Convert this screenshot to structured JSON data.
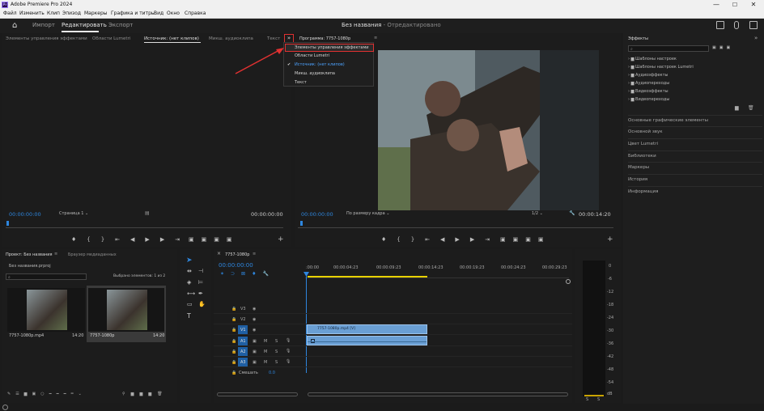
{
  "window": {
    "app_title": "Adobe Premiere Pro 2024",
    "logo_text": "Pr",
    "controls": [
      "—",
      "☐",
      "✕"
    ]
  },
  "menubar": [
    "Файл",
    "Изменить",
    "Клип",
    "Эпизод",
    "Маркеры",
    "Графика и титры",
    "Вид",
    "Окно",
    "Справка"
  ],
  "header": {
    "tabs": [
      "Импорт",
      "Редактировать",
      "Экспорт"
    ],
    "active_tab": "Редактировать",
    "doc_title": "Без названия",
    "doc_status": " - Отредактировано"
  },
  "source_panel": {
    "tabs": [
      "Элементы управления эффектами",
      "Области Lumetri",
      "Источник: (нет клипов)",
      "Микш. аудиоклипа",
      "Текст"
    ],
    "active_tab": "Источник: (нет клипов)",
    "overflow_icon": "»",
    "timecode_left": "00:00:00:00",
    "page_label": "Страница 1",
    "timecode_right": "00:00:00:00"
  },
  "program_panel": {
    "title": "Программа: 7757-1080p",
    "timecode_left": "00:00:00:00",
    "fit_label": "По размеру кадра",
    "resolution": "1/2",
    "timecode_right": "00:00:14:20"
  },
  "dropdown_menu": {
    "items": [
      "Элементы управления эффектами",
      "Области Lumetri",
      "Источник: (нет клипов)",
      "Микш. аудиоклипа",
      "Текст"
    ],
    "highlighted": "Элементы управления эффектами",
    "checked": "Источник: (нет клипов)",
    "accent": "#e03131"
  },
  "effects_panel": {
    "title": "Эффекты",
    "tree": [
      "Шаблоны настроек",
      "Шаблоны настроек Lumetri",
      "Аудиоэффекты",
      "Аудиопереходы",
      "Видеоэффекты",
      "Видеопереходы"
    ],
    "sections": [
      "Основные графические элементы",
      "Основной звук",
      "Цвет Lumetri",
      "Библиотеки",
      "Маркеры",
      "История",
      "Информация"
    ]
  },
  "project_panel": {
    "tabs": [
      "Проект: Без названия",
      "Браузер медиаданных"
    ],
    "project_file": "Без названия.prproj",
    "selection_info": "Выбрано элементов: 1 из 2",
    "items": [
      {
        "name": "7757-1080p.mp4",
        "duration": "14:20"
      },
      {
        "name": "7757-1080p",
        "duration": "14:20"
      }
    ]
  },
  "timeline": {
    "sequence_name": "7757-1080p",
    "timecode": "00:00:00:00",
    "ruler": [
      ":00:00",
      "00:00:04:23",
      "00:00:09:23",
      "00:00:14:23",
      "00:00:19:23",
      "00:00:24:23",
      "00:00:29:23"
    ],
    "video_tracks": [
      "V3",
      "V2",
      "V1"
    ],
    "audio_tracks": [
      "A1",
      "A2",
      "A3"
    ],
    "track_letters": {
      "mute": "M",
      "solo": "S"
    },
    "clip_video_label": "7757-1080p.mp4 [V]",
    "mix_label": "Смешать",
    "mix_value": "0.0",
    "clip_color": "#6a9fd4"
  },
  "audio_meter": {
    "scale": [
      "0",
      "-6",
      "-12",
      "-18",
      "-24",
      "-30",
      "-36",
      "-42",
      "-48",
      "-54"
    ],
    "unit": "dB",
    "footer": [
      "S",
      "S"
    ]
  },
  "colors": {
    "accent_blue": "#2e86de",
    "highlight_red": "#e03131",
    "timeline_yellow": "#e8d100"
  }
}
